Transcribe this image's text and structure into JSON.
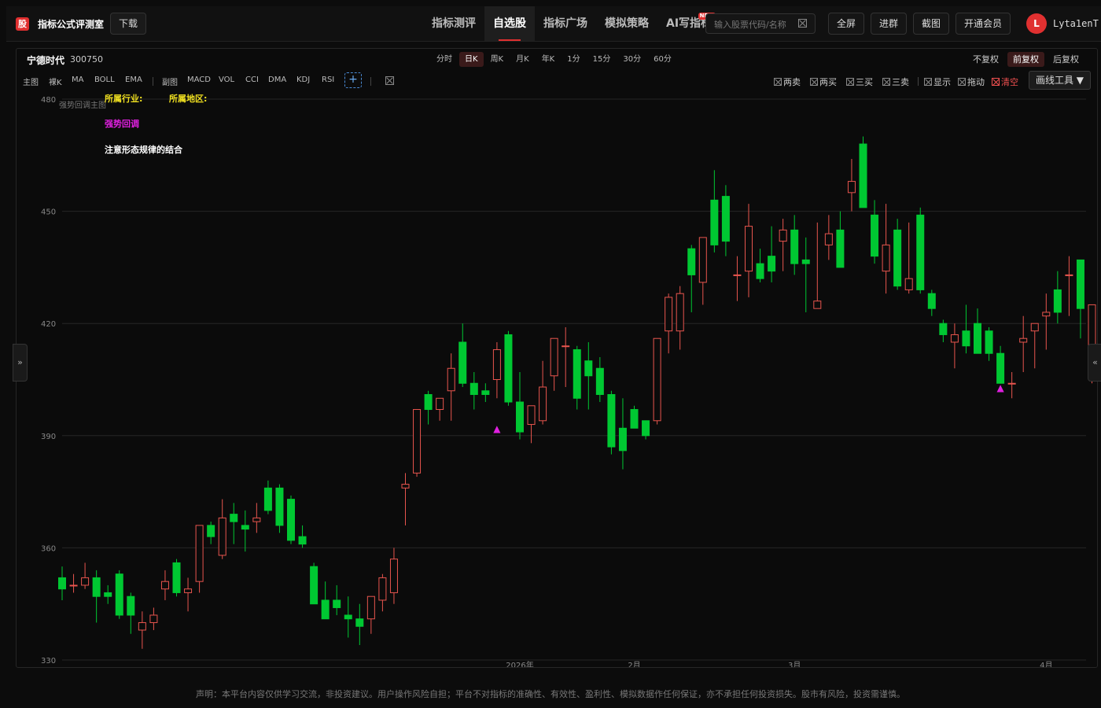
{
  "header": {
    "logo_char": "股",
    "title": "指标公式评测室",
    "download_label": "下载",
    "nav": [
      {
        "label": "指标测评",
        "active": false
      },
      {
        "label": "自选股",
        "active": true
      },
      {
        "label": "指标广场",
        "active": false
      },
      {
        "label": "模拟策略",
        "active": false
      },
      {
        "label": "AI写指标",
        "active": false,
        "badge": "NEW"
      }
    ],
    "search_placeholder": "输入股票代码/名称",
    "buttons": [
      "全屏",
      "进群",
      "截图",
      "开通会员"
    ],
    "avatar_letter": "L",
    "username": "Lyta1enT"
  },
  "stock": {
    "name": "宁德时代",
    "code": "300750"
  },
  "periods": [
    {
      "label": "分时",
      "active": false
    },
    {
      "label": "日K",
      "active": true
    },
    {
      "label": "周K",
      "active": false
    },
    {
      "label": "月K",
      "active": false
    },
    {
      "label": "年K",
      "active": false
    },
    {
      "label": "1分",
      "active": false
    },
    {
      "label": "15分",
      "active": false
    },
    {
      "label": "30分",
      "active": false
    },
    {
      "label": "60分",
      "active": false
    }
  ],
  "adjust": [
    {
      "label": "不复权",
      "active": false
    },
    {
      "label": "前复权",
      "active": true
    },
    {
      "label": "后复权",
      "active": false
    }
  ],
  "indicators": {
    "main_label": "主图",
    "main": [
      "裸K",
      "MA",
      "BOLL",
      "EMA"
    ],
    "sub_label": "副图",
    "sub": [
      "MACD",
      "VOL",
      "CCI",
      "DMA",
      "KDJ",
      "RSI"
    ]
  },
  "tools": [
    {
      "label": "两卖",
      "red": false
    },
    {
      "label": "两买",
      "red": false
    },
    {
      "label": "三买",
      "red": false
    },
    {
      "label": "三卖",
      "red": false
    },
    {
      "label": "显示",
      "red": false
    },
    {
      "label": "拖动",
      "red": false
    },
    {
      "label": "清空",
      "red": true
    }
  ],
  "draw_tools_label": "画线工具 ▼",
  "overlay": {
    "main_label": "强势回调主图",
    "industry_label": "所属行业:",
    "region_label": "所属地区:",
    "signal_name": "强势回调",
    "note": "注意形态规律的结合"
  },
  "side_left": "»",
  "side_right": "«",
  "footer": "声明：本平台内容仅供学习交流，非投资建议。用户操作风险自担；平台不对指标的准确性、有效性、盈利性、模拟数据作任何保证，亦不承担任何投资损失。股市有风险，投资需谨慎。",
  "colors": {
    "up": "#e8554e",
    "down": "#00c832",
    "signal": "#e020e0",
    "accent": "#e03030",
    "industry_text": "#f0e020"
  },
  "chart_data": {
    "type": "candlestick",
    "ylim": [
      330,
      480
    ],
    "y_ticks": [
      330,
      360,
      390,
      420,
      450,
      480
    ],
    "x_labels": [
      {
        "index": 40,
        "label": "2026年"
      },
      {
        "index": 50,
        "label": "2月"
      },
      {
        "index": 64,
        "label": "3月"
      },
      {
        "index": 86,
        "label": "4月"
      }
    ],
    "candles": [
      [
        352,
        355,
        346,
        349
      ],
      [
        350,
        353,
        348,
        350
      ],
      [
        350,
        356,
        349,
        352
      ],
      [
        352,
        354,
        340,
        347
      ],
      [
        348,
        350,
        345,
        347
      ],
      [
        353,
        354,
        341,
        342
      ],
      [
        347,
        348,
        337,
        342
      ],
      [
        338,
        343,
        333,
        340
      ],
      [
        340,
        344,
        338,
        342
      ],
      [
        349,
        354,
        346,
        351
      ],
      [
        356,
        357,
        347,
        348
      ],
      [
        348,
        352,
        343,
        349
      ],
      [
        351,
        366,
        348,
        366
      ],
      [
        366,
        367,
        361,
        363
      ],
      [
        358,
        373,
        357,
        368
      ],
      [
        369,
        372,
        361,
        367
      ],
      [
        366,
        370,
        359,
        365
      ],
      [
        367,
        372,
        364,
        368
      ],
      [
        376,
        378,
        369,
        370
      ],
      [
        376,
        377,
        364,
        366
      ],
      [
        373,
        374,
        361,
        362
      ],
      [
        363,
        366,
        360,
        361
      ],
      [
        355,
        356,
        345,
        345
      ],
      [
        346,
        351,
        341,
        341
      ],
      [
        346,
        350,
        342,
        344
      ],
      [
        342,
        347,
        336,
        341
      ],
      [
        341,
        345,
        334,
        339
      ],
      [
        341,
        347,
        337,
        347
      ],
      [
        346,
        353,
        343,
        352
      ],
      [
        348,
        360,
        345,
        357
      ],
      [
        376,
        380,
        366,
        377
      ],
      [
        380,
        397,
        379,
        397
      ],
      [
        401,
        402,
        393,
        397
      ],
      [
        397,
        400,
        394,
        400
      ],
      [
        402,
        412,
        394,
        408
      ],
      [
        415,
        420,
        403,
        404
      ],
      [
        404,
        407,
        397,
        401
      ],
      [
        402,
        404,
        399,
        401
      ],
      [
        405,
        415,
        400,
        413
      ],
      [
        417,
        418,
        398,
        399
      ],
      [
        399,
        407,
        389,
        391
      ],
      [
        393,
        396,
        388,
        398
      ],
      [
        394,
        410,
        393,
        403
      ],
      [
        406,
        416,
        402,
        416
      ],
      [
        414,
        419,
        403,
        414
      ],
      [
        413,
        414,
        397,
        400
      ],
      [
        410,
        415,
        397,
        406
      ],
      [
        408,
        411,
        399,
        401
      ],
      [
        401,
        402,
        385,
        387
      ],
      [
        392,
        400,
        381,
        386
      ],
      [
        397,
        398,
        392,
        392
      ],
      [
        394,
        394,
        389,
        390
      ],
      [
        394,
        415,
        393,
        416
      ],
      [
        418,
        428,
        412,
        427
      ],
      [
        418,
        430,
        413,
        428
      ],
      [
        440,
        441,
        423,
        433
      ],
      [
        431,
        442,
        425,
        443
      ],
      [
        453,
        461,
        439,
        441
      ],
      [
        454,
        457,
        438,
        442
      ],
      [
        433,
        438,
        426,
        433
      ],
      [
        434,
        452,
        427,
        446
      ],
      [
        436,
        440,
        431,
        432
      ],
      [
        438,
        446,
        431,
        434
      ],
      [
        442,
        448,
        434,
        445
      ],
      [
        445,
        449,
        433,
        436
      ],
      [
        437,
        443,
        423,
        436
      ],
      [
        424,
        447,
        424,
        426
      ],
      [
        441,
        449,
        437,
        444
      ],
      [
        445,
        450,
        437,
        435
      ],
      [
        455,
        464,
        450,
        458
      ],
      [
        468,
        470,
        453,
        451
      ],
      [
        449,
        453,
        436,
        438
      ],
      [
        434,
        452,
        428,
        441
      ],
      [
        445,
        448,
        429,
        430
      ],
      [
        429,
        447,
        428,
        432
      ],
      [
        449,
        451,
        428,
        429
      ],
      [
        428,
        429,
        422,
        424
      ],
      [
        420,
        421,
        415,
        417
      ],
      [
        415,
        420,
        408,
        417
      ],
      [
        418,
        425,
        412,
        414
      ],
      [
        420,
        424,
        412,
        412
      ],
      [
        418,
        419,
        410,
        412
      ],
      [
        412,
        414,
        404,
        404
      ],
      [
        404,
        407,
        400,
        404
      ],
      [
        415,
        422,
        407,
        416
      ],
      [
        418,
        419,
        408,
        420
      ],
      [
        422,
        428,
        413,
        423
      ],
      [
        429,
        434,
        420,
        423
      ],
      [
        433,
        438,
        422,
        433
      ],
      [
        437,
        437,
        416,
        424
      ],
      [
        410,
        425,
        404,
        425
      ],
      [
        410,
        413,
        405,
        406
      ]
    ],
    "signals": [
      {
        "index": 38,
        "price": 391,
        "label": "▲"
      },
      {
        "index": 82,
        "price": 402,
        "label": "▲"
      }
    ]
  }
}
